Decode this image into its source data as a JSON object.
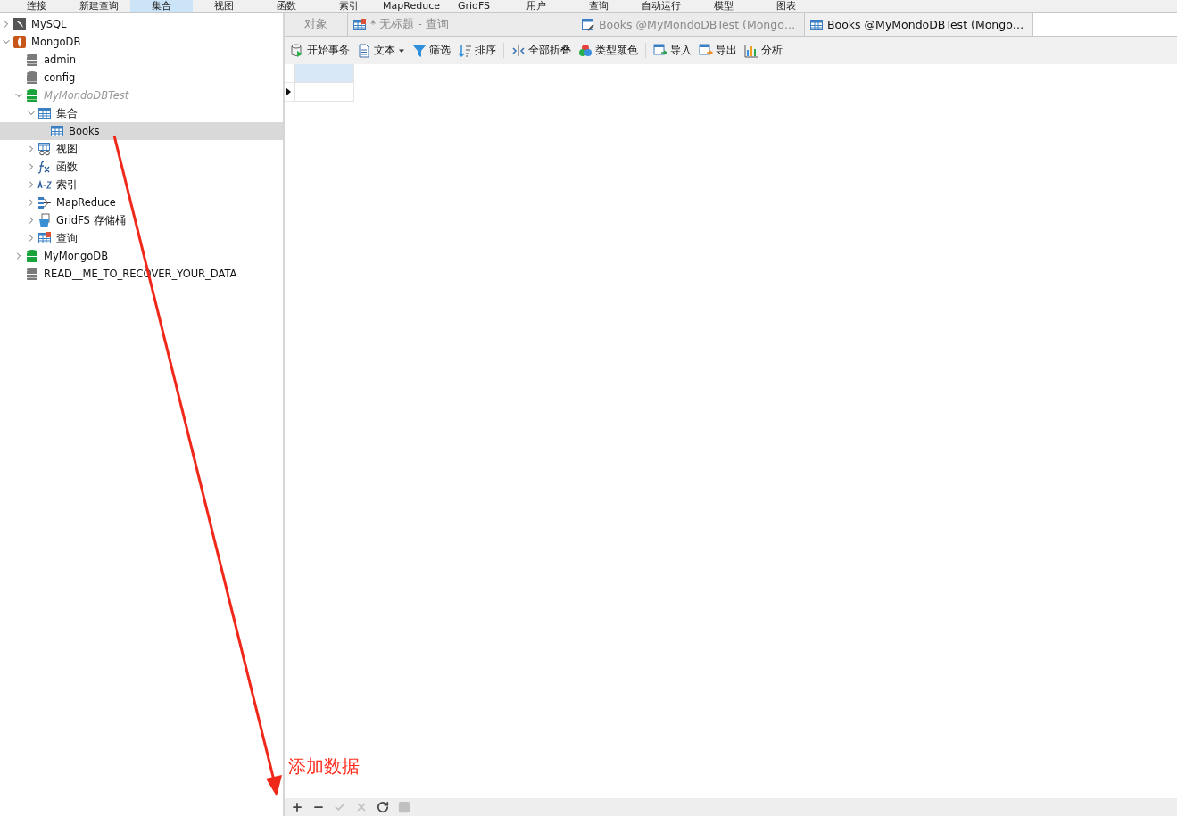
{
  "menu_bar": [
    {
      "label": "连接",
      "selected": false
    },
    {
      "label": "新建查询",
      "selected": false
    },
    {
      "label": "集合",
      "selected": true
    },
    {
      "label": "视图",
      "selected": false
    },
    {
      "label": "函数",
      "selected": false
    },
    {
      "label": "索引",
      "selected": false
    },
    {
      "label": "MapReduce",
      "selected": false
    },
    {
      "label": "GridFS",
      "selected": false
    },
    {
      "label": "用户",
      "selected": false
    },
    {
      "label": "查询",
      "selected": false
    },
    {
      "label": "自动运行",
      "selected": false
    },
    {
      "label": "模型",
      "selected": false
    },
    {
      "label": "图表",
      "selected": false
    }
  ],
  "sidebar": {
    "tree": [
      {
        "label": "MySQL",
        "kind": "mysql",
        "expanded": false,
        "selected": false,
        "italic": false
      },
      {
        "label": "MongoDB",
        "kind": "mongo",
        "expanded": true,
        "selected": false,
        "italic": false,
        "children": [
          {
            "label": "admin",
            "kind": "db",
            "selected": false,
            "italic": false
          },
          {
            "label": "config",
            "kind": "db",
            "selected": false,
            "italic": false
          },
          {
            "label": "MyMondoDBTest",
            "kind": "db-open",
            "expanded": true,
            "selected": false,
            "italic": true,
            "children": [
              {
                "label": "集合",
                "kind": "table",
                "expanded": true,
                "selected": false,
                "italic": false,
                "children": [
                  {
                    "label": "Books",
                    "kind": "table",
                    "selected": true,
                    "italic": false
                  }
                ]
              },
              {
                "label": "视图",
                "kind": "view",
                "expanded": false,
                "selected": false,
                "italic": false
              },
              {
                "label": "函数",
                "kind": "function",
                "expanded": false,
                "selected": false,
                "italic": false
              },
              {
                "label": "索引",
                "kind": "index",
                "expanded": false,
                "selected": false,
                "italic": false
              },
              {
                "label": "MapReduce",
                "kind": "mapreduce",
                "expanded": false,
                "selected": false,
                "italic": false
              },
              {
                "label": "GridFS 存储桶",
                "kind": "gridfs",
                "expanded": false,
                "selected": false,
                "italic": false
              },
              {
                "label": "查询",
                "kind": "query",
                "expanded": false,
                "selected": false,
                "italic": false
              }
            ]
          },
          {
            "label": "MyMongoDB",
            "kind": "db-open",
            "expanded": false,
            "selected": false,
            "italic": false
          },
          {
            "label": "READ__ME_TO_RECOVER_YOUR_DATA",
            "kind": "db",
            "selected": false,
            "italic": false
          }
        ]
      }
    ]
  },
  "tabs": [
    {
      "label": "对象",
      "kind": "object",
      "selected": false
    },
    {
      "label": "* 无标题 - 查询",
      "kind": "query",
      "selected": false
    },
    {
      "label": "Books @MyMondoDBTest (Mongo…",
      "kind": "edit",
      "selected": false
    },
    {
      "label": "Books @MyMondoDBTest (Mongo…",
      "kind": "table",
      "selected": true
    }
  ],
  "toolbar": [
    [
      {
        "label": "开始事务",
        "kind": "transaction"
      },
      {
        "label": "文本",
        "kind": "text",
        "dropdown": true
      },
      {
        "label": "筛选",
        "kind": "filter"
      },
      {
        "label": "排序",
        "kind": "sort"
      }
    ],
    [
      {
        "label": "全部折叠",
        "kind": "collapse"
      },
      {
        "label": "类型颜色",
        "kind": "color"
      }
    ],
    [
      {
        "label": "导入",
        "kind": "import"
      },
      {
        "label": "导出",
        "kind": "export"
      },
      {
        "label": "分析",
        "kind": "chart"
      }
    ]
  ],
  "annotation": {
    "text": "添加数据"
  },
  "bottom_bar": [
    {
      "kind": "add",
      "disabled": false
    },
    {
      "kind": "remove",
      "disabled": false
    },
    {
      "kind": "apply",
      "disabled": true
    },
    {
      "kind": "cancel",
      "disabled": true
    },
    {
      "kind": "refresh",
      "disabled": false
    },
    {
      "kind": "stop",
      "disabled": true
    }
  ]
}
